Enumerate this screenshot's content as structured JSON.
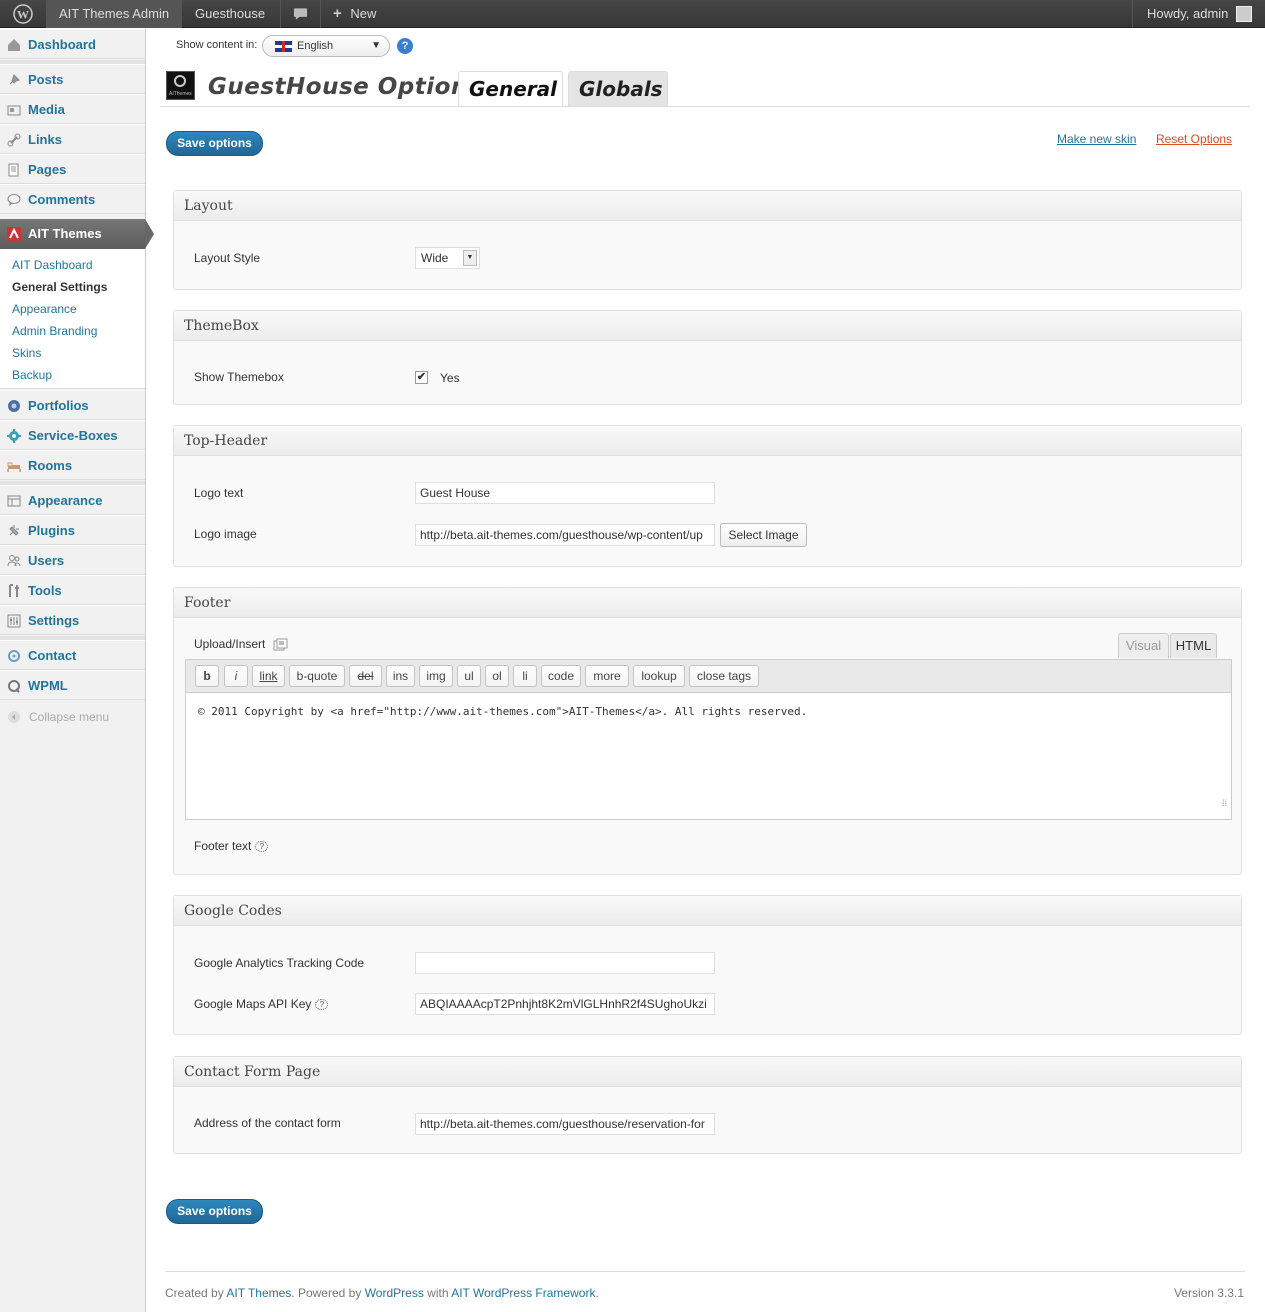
{
  "adminbar": {
    "site_name": "AIT Themes Admin",
    "guesthouse": "Guesthouse",
    "new_label": "New",
    "howdy": "Howdy, admin"
  },
  "sidebar": {
    "items_top": [
      "Dashboard",
      "Posts",
      "Media",
      "Links",
      "Pages",
      "Comments"
    ],
    "active": "AIT Themes",
    "submenu": [
      "AIT Dashboard",
      "General Settings",
      "Appearance",
      "Admin Branding",
      "Skins",
      "Backup"
    ],
    "items_mid": [
      "Portfolios",
      "Service-Boxes",
      "Rooms"
    ],
    "items_bottom": [
      "Appearance",
      "Plugins",
      "Users",
      "Tools",
      "Settings"
    ],
    "items_extra": [
      "Contact",
      "WPML"
    ],
    "collapse": "Collapse menu"
  },
  "header": {
    "show_content_in": "Show content in:",
    "language": "English",
    "title": "GuestHouse Options",
    "tabs": [
      "General",
      "Globals"
    ],
    "save_label": "Save options",
    "make_new_skin": "Make new skin",
    "reset_options": "Reset Options"
  },
  "sections": {
    "layout": {
      "title": "Layout",
      "layout_style_label": "Layout Style",
      "layout_style_value": "Wide"
    },
    "themebox": {
      "title": "ThemeBox",
      "show_label": "Show Themebox",
      "show_checked": true,
      "show_value": "Yes"
    },
    "top_header": {
      "title": "Top-Header",
      "logo_text_label": "Logo text",
      "logo_text_value": "Guest House",
      "logo_image_label": "Logo image",
      "logo_image_value": "http://beta.ait-themes.com/guesthouse/wp-content/up",
      "select_image": "Select Image"
    },
    "footer": {
      "title": "Footer",
      "upload_insert": "Upload/Insert",
      "tab_visual": "Visual",
      "tab_html": "HTML",
      "quicktags": [
        "b",
        "i",
        "link",
        "b-quote",
        "del",
        "ins",
        "img",
        "ul",
        "ol",
        "li",
        "code",
        "more",
        "lookup",
        "close tags"
      ],
      "content": "© 2011 Copyright by <a href=\"http://www.ait-themes.com\">AIT-Themes</a>. All rights reserved.",
      "footer_text_label": "Footer text"
    },
    "google": {
      "title": "Google Codes",
      "analytics_label": "Google Analytics Tracking Code",
      "analytics_value": "",
      "maps_label": "Google Maps API Key",
      "maps_value": "ABQIAAAAcpT2Pnhjht8K2mVlGLHnhR2f4SUghoUkzi"
    },
    "contact": {
      "title": "Contact Form Page",
      "address_label": "Address of the contact form",
      "address_value": "http://beta.ait-themes.com/guesthouse/reservation-for"
    }
  },
  "footer": {
    "created_by": "Created by",
    "ait_themes": "AIT Themes",
    "powered_by": ". Powered by",
    "wordpress": "WordPress",
    "with": "with",
    "framework": "AIT WordPress Framework",
    "period": ".",
    "version": "Version 3.3.1"
  }
}
